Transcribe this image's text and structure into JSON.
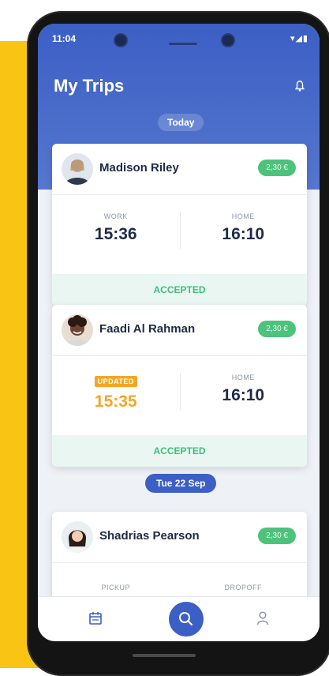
{
  "status_bar": {
    "time": "11:04",
    "icons": "▾◢▮"
  },
  "header": {
    "title": "My Trips",
    "day_label": "Today"
  },
  "trips": [
    {
      "name": "Madison Riley",
      "price": "2,30 €",
      "left_label": "WORK",
      "left_time": "15:36",
      "right_label": "HOME",
      "right_time": "16:10",
      "status": "ACCEPTED"
    },
    {
      "name": "Faadi Al Rahman",
      "price": "2,30 €",
      "left_label": "UPDATED",
      "left_time": "15:35",
      "right_label": "HOME",
      "right_time": "16:10",
      "status": "ACCEPTED"
    },
    {
      "name": "Shadrias Pearson",
      "price": "2,30 €",
      "left_label": "PICKUP",
      "right_label": "DROPOFF"
    }
  ],
  "section_date": "Tue 22 Sep",
  "colors": {
    "accent": "#3b5fc4",
    "success": "#4dc27b",
    "warning": "#f5a623",
    "background": "#f9c413"
  },
  "nav": {
    "items": [
      "calendar-icon",
      "search-icon",
      "user-icon"
    ]
  }
}
